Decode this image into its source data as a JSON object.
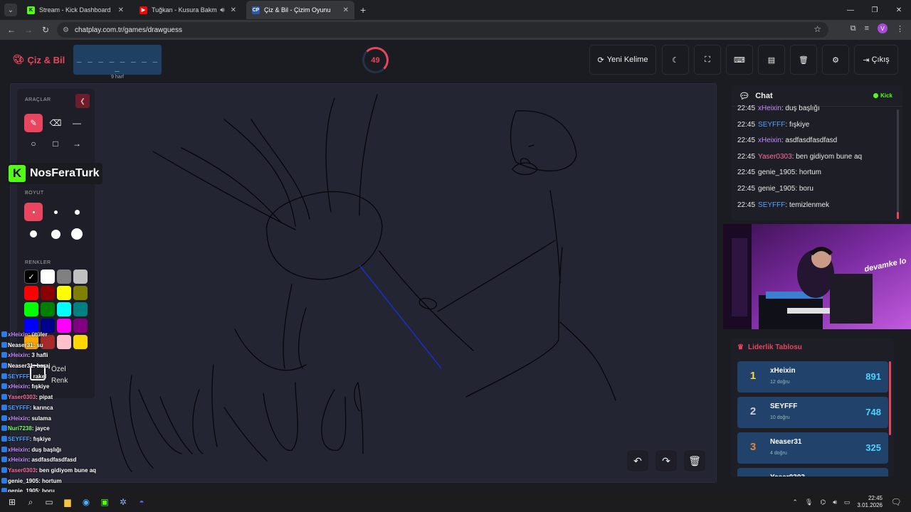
{
  "browser": {
    "tabs": [
      {
        "title": "Stream - Kick Dashboard",
        "fav": "K",
        "fav_color": "#53fc18"
      },
      {
        "title": "Tuğkan - Kusura Bakma (Offi",
        "fav": "▶",
        "fav_color": "#ff0000"
      },
      {
        "title": "Çiz & Bil - Çizim Oyunu",
        "fav": "CP",
        "fav_color": "#2b5aa8"
      }
    ],
    "url": "chatplay.com.tr/games/drawguess",
    "profile_initial": "V"
  },
  "header": {
    "logo": "Çiz & Bil",
    "word_blanks": "_ _ _ _ _ _ _ _ _",
    "hint": "9 harf",
    "timer": "49",
    "buttons": {
      "new_word": "Yeni Kelime",
      "exit": "Çıkış"
    }
  },
  "tools": {
    "section_tools": "ARAÇLAR",
    "section_size": "BOYUT",
    "section_colors": "RENKLER",
    "custom_color": "Özel Renk",
    "colors": [
      "#000000",
      "#ffffff",
      "#808080",
      "#c0c0c0",
      "#ff0000",
      "#8b0000",
      "#ffff00",
      "#808000",
      "#00ff00",
      "#008000",
      "#00ffff",
      "#008080",
      "#0000ff",
      "#00008b",
      "#ff00ff",
      "#800080",
      "#ffa500",
      "#a52a2a",
      "#ffc0cb",
      "#ffd700"
    ]
  },
  "overlay": {
    "streamer": "NosFeraTurk",
    "messages": [
      {
        "user": "xHeixin",
        "text": "ütüler",
        "color": "#c78bff"
      },
      {
        "user": "Neaser31",
        "text": "su",
        "color": "#ffffff"
      },
      {
        "user": "xHeixin",
        "text": "3 hafli",
        "color": "#c78bff"
      },
      {
        "user": "Neaser31",
        "text": "baraj",
        "color": "#ffffff"
      },
      {
        "user": "SEYFFF",
        "text": "rakel",
        "color": "#4fa3ff"
      },
      {
        "user": "xHeixin",
        "text": "fışkiye",
        "color": "#c78bff"
      },
      {
        "user": "Yaser0303",
        "text": "pipat",
        "color": "#ff6fa0"
      },
      {
        "user": "SEYFFF",
        "text": "karınca",
        "color": "#4fa3ff"
      },
      {
        "user": "xHeixin",
        "text": "sulama",
        "color": "#c78bff"
      },
      {
        "user": "Nuri7238",
        "text": "jayce",
        "color": "#7cff6a"
      },
      {
        "user": "SEYFFF",
        "text": "fışkiye",
        "color": "#4fa3ff"
      },
      {
        "user": "xHeixin",
        "text": "duş başlığı",
        "color": "#c78bff"
      },
      {
        "user": "xHeixin",
        "text": "asdfasdfasdfasd",
        "color": "#c78bff"
      },
      {
        "user": "Yaser0303",
        "text": "ben gidiyom bune aq",
        "color": "#ff6fa0"
      },
      {
        "user": "genie_1905",
        "text": "hortum",
        "color": "#ffffff"
      },
      {
        "user": "genie_1905",
        "text": "boru",
        "color": "#ffffff"
      },
      {
        "user": "SEYFFF",
        "text": "temizlenmek",
        "color": "#4fa3ff"
      }
    ]
  },
  "chat": {
    "title": "Chat",
    "source": "Kick",
    "messages": [
      {
        "time": "22:45",
        "user": "xHeixin",
        "text": "duş başlığı",
        "color": "#c78bff"
      },
      {
        "time": "22:45",
        "user": "SEYFFF",
        "text": "fışkiye",
        "color": "#4fa3ff"
      },
      {
        "time": "22:45",
        "user": "xHeixin",
        "text": "asdfasdfasdfasd",
        "color": "#c78bff"
      },
      {
        "time": "22:45",
        "user": "Yaser0303",
        "text": "ben gidiyom bune aq",
        "color": "#ff6fa0"
      },
      {
        "time": "22:45",
        "user": "genie_1905",
        "text": "hortum",
        "color": "#e8e8e8"
      },
      {
        "time": "22:45",
        "user": "genie_1905",
        "text": "boru",
        "color": "#e8e8e8"
      },
      {
        "time": "22:45",
        "user": "SEYFFF",
        "text": "temizlenmek",
        "color": "#4fa3ff"
      }
    ]
  },
  "webcam": {
    "tag": "devamke lo"
  },
  "leaderboard": {
    "title": "Liderlik Tablosu",
    "rows": [
      {
        "rank": "1",
        "name": "xHeixin",
        "sub": "12 doğru",
        "score": "891",
        "rank_color": "#ffd23f"
      },
      {
        "rank": "2",
        "name": "SEYFFF",
        "sub": "10 doğru",
        "score": "748",
        "rank_color": "#d0d0d0"
      },
      {
        "rank": "3",
        "name": "Neaser31",
        "sub": "4 doğru",
        "score": "325",
        "rank_color": "#e0883a"
      },
      {
        "rank": "",
        "name": "Yaser0303",
        "sub": "",
        "score": "",
        "rank_color": "#ffffff"
      }
    ]
  },
  "taskbar": {
    "time": "22:45",
    "date": "3.01.2026"
  }
}
